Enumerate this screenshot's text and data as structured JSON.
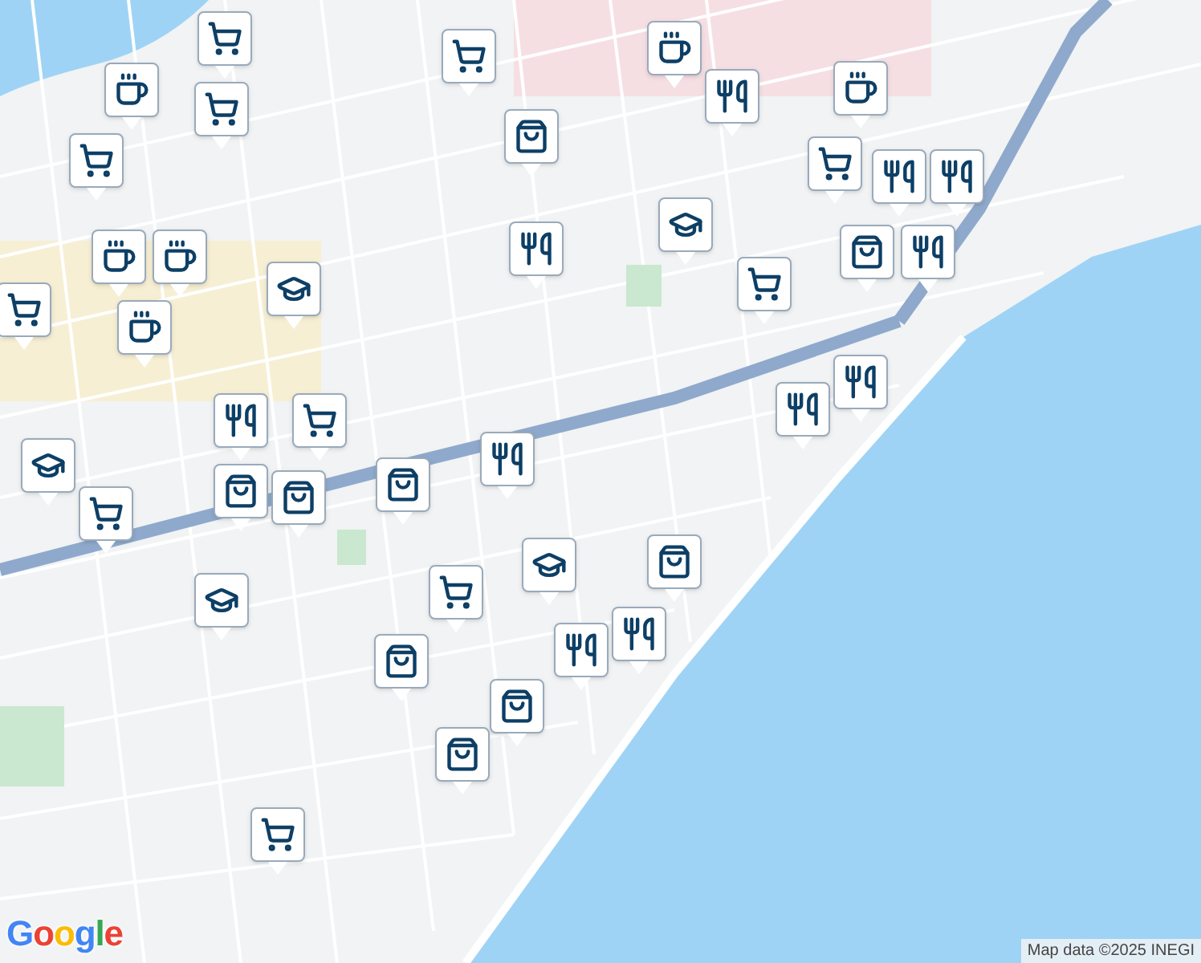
{
  "markers": [
    {
      "kind": "cart"
    },
    {
      "kind": "cart"
    },
    {
      "kind": "cart"
    },
    {
      "kind": "coffee"
    },
    {
      "kind": "cart"
    },
    {
      "kind": "bag"
    },
    {
      "kind": "coffee"
    },
    {
      "kind": "restaurant"
    },
    {
      "kind": "coffee"
    },
    {
      "kind": "cart"
    },
    {
      "kind": "restaurant"
    },
    {
      "kind": "restaurant"
    },
    {
      "kind": "bag"
    },
    {
      "kind": "restaurant"
    },
    {
      "kind": "school"
    },
    {
      "kind": "restaurant"
    },
    {
      "kind": "coffee"
    },
    {
      "kind": "coffee"
    },
    {
      "kind": "school"
    },
    {
      "kind": "coffee"
    },
    {
      "kind": "cart"
    },
    {
      "kind": "cart"
    },
    {
      "kind": "restaurant"
    },
    {
      "kind": "restaurant"
    },
    {
      "kind": "cart"
    },
    {
      "kind": "restaurant"
    },
    {
      "kind": "bag"
    },
    {
      "kind": "bag"
    },
    {
      "kind": "school"
    },
    {
      "kind": "cart"
    },
    {
      "kind": "bag"
    },
    {
      "kind": "restaurant"
    },
    {
      "kind": "school"
    },
    {
      "kind": "bag"
    },
    {
      "kind": "cart"
    },
    {
      "kind": "school"
    },
    {
      "kind": "bag"
    },
    {
      "kind": "restaurant"
    },
    {
      "kind": "restaurant"
    },
    {
      "kind": "bag"
    },
    {
      "kind": "bag"
    },
    {
      "kind": "cart"
    }
  ],
  "logo": "Google",
  "attribution": "Map data ©2025 INEGI"
}
